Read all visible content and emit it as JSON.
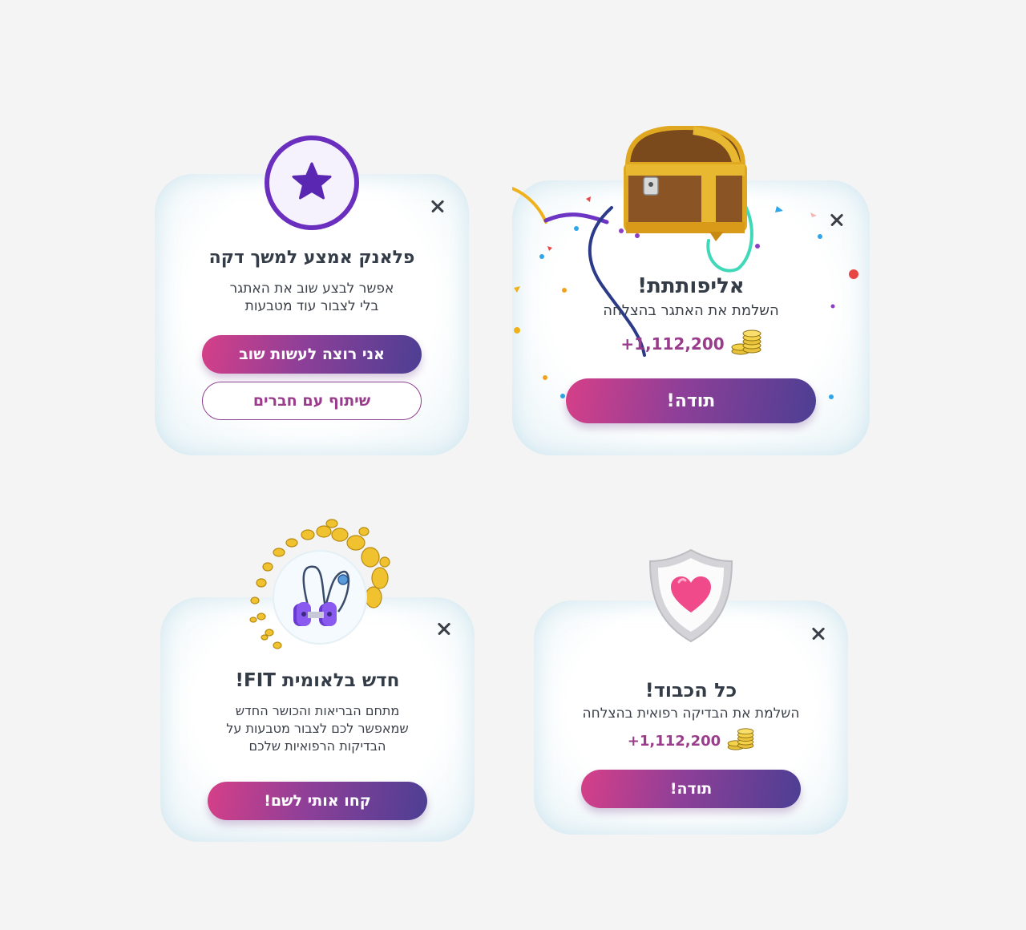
{
  "plank_card": {
    "title": "פלאנק אמצע למשך דקה",
    "line1": "אפשר לבצע שוב את האתגר",
    "line2": "בלי לצבור עוד מטבעות",
    "primary_button": "אני רוצה לעשות שוב",
    "secondary_button": "שיתוף עם חברים"
  },
  "champion_card": {
    "title": "אליפותתת!",
    "subtitle": "השלמת את האתגר בהצלחה",
    "reward": "+1,112,200",
    "button": "תודה!"
  },
  "fit_card": {
    "title": "חדש בלאומית FIT!",
    "line1": "מתחם הבריאות והכושר החדש",
    "line2": "שמאפשר לכם לצבור מטבעות על",
    "line3": "הבדיקות הרפואיות שלכם",
    "button": "קחו אותי לשם!"
  },
  "honor_card": {
    "title": "כל הכבוד!",
    "subtitle": "השלמת את הבדיקה רפואית בהצלחה",
    "reward": "+1,112,200",
    "button": "תודה!"
  },
  "colors": {
    "background": "#f4f4f4",
    "accent_purple": "#6b2fbf",
    "gradient_start": "#d63f88",
    "gradient_end": "#4c3f93",
    "reward_text": "#9a3c8c"
  },
  "icons": [
    "star-badge-icon",
    "treasure-chest-icon",
    "coin-stack-icon",
    "stethoscope-dumbbell-icon",
    "heart-shield-icon",
    "close-icon",
    "confetti"
  ]
}
